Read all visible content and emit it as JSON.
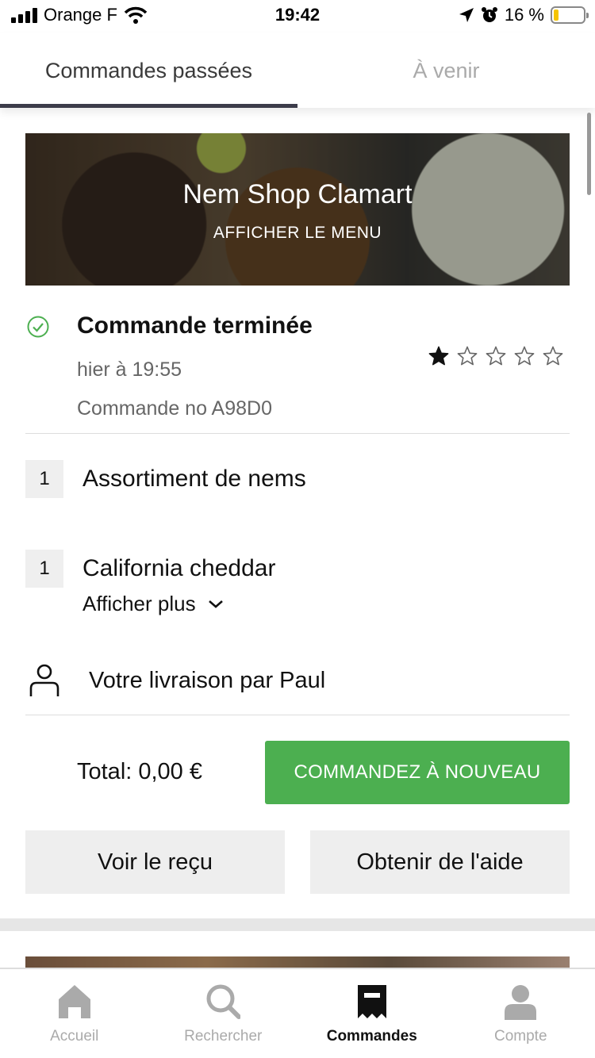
{
  "status_bar": {
    "carrier": "Orange F",
    "time": "19:42",
    "battery_percent": "16 %",
    "battery_level": 0.16,
    "icons": [
      "signal-icon",
      "wifi-icon",
      "location-arrow-icon",
      "alarm-icon",
      "battery-icon"
    ]
  },
  "tabs": {
    "past": "Commandes passées",
    "upcoming": "À venir"
  },
  "banner": {
    "restaurant_name": "Nem Shop Clamart",
    "menu_link": "AFFICHER LE MENU"
  },
  "order": {
    "status": "Commande terminée",
    "time": "hier à 19:55",
    "number": "Commande no A98D0",
    "rating": 1,
    "rating_max": 5,
    "items": [
      {
        "quantity": "1",
        "name": "Assortiment de nems"
      },
      {
        "quantity": "1",
        "name": "California cheddar"
      }
    ],
    "show_more": "Afficher plus",
    "courier": "Votre livraison par Paul",
    "total": "Total: 0,00 €",
    "reorder_label": "COMMANDEZ À NOUVEAU",
    "receipt_label": "Voir le reçu",
    "help_label": "Obtenir de l'aide"
  },
  "colors": {
    "accent_green": "#4caf50",
    "tab_indicator": "#3c3c4a"
  },
  "bottom_nav": [
    {
      "label": "Accueil",
      "icon": "home-icon",
      "active": false
    },
    {
      "label": "Rechercher",
      "icon": "search-icon",
      "active": false
    },
    {
      "label": "Commandes",
      "icon": "receipt-icon",
      "active": true
    },
    {
      "label": "Compte",
      "icon": "account-icon",
      "active": false
    }
  ]
}
